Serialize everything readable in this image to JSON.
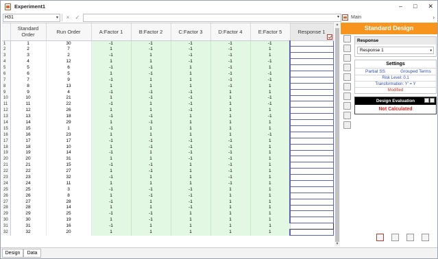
{
  "window": {
    "title": "Experiment1",
    "minimize": "–",
    "maximize": "□",
    "close": "✕"
  },
  "formula_bar": {
    "cell_ref": "H31",
    "cancel": "×",
    "confirm": "✓",
    "value": ""
  },
  "columns": [
    "Standard Order",
    "Run Order",
    "A:Factor 1",
    "B:Factor 2",
    "C:Factor 3",
    "D:Factor 4",
    "E:Factor 5",
    "Response 1"
  ],
  "rows": [
    [
      1,
      30,
      -1,
      -1,
      -1,
      -1,
      -1
    ],
    [
      2,
      7,
      1,
      -1,
      -1,
      -1,
      1
    ],
    [
      3,
      2,
      -1,
      1,
      -1,
      -1,
      1
    ],
    [
      4,
      12,
      1,
      1,
      -1,
      -1,
      -1
    ],
    [
      5,
      6,
      -1,
      -1,
      1,
      -1,
      1
    ],
    [
      6,
      5,
      1,
      -1,
      1,
      -1,
      -1
    ],
    [
      7,
      9,
      -1,
      1,
      1,
      -1,
      -1
    ],
    [
      8,
      13,
      1,
      1,
      1,
      -1,
      1
    ],
    [
      9,
      4,
      -1,
      -1,
      -1,
      1,
      1
    ],
    [
      10,
      21,
      1,
      -1,
      -1,
      1,
      -1
    ],
    [
      11,
      22,
      -1,
      1,
      -1,
      1,
      -1
    ],
    [
      12,
      26,
      1,
      1,
      -1,
      1,
      1
    ],
    [
      13,
      18,
      -1,
      -1,
      1,
      1,
      -1
    ],
    [
      14,
      29,
      1,
      -1,
      1,
      1,
      1
    ],
    [
      15,
      1,
      -1,
      1,
      1,
      1,
      1
    ],
    [
      16,
      23,
      1,
      1,
      1,
      1,
      -1
    ],
    [
      17,
      17,
      -1,
      -1,
      -1,
      -1,
      1
    ],
    [
      18,
      10,
      1,
      -1,
      -1,
      -1,
      1
    ],
    [
      19,
      14,
      -1,
      1,
      -1,
      -1,
      1
    ],
    [
      20,
      31,
      1,
      1,
      -1,
      -1,
      1
    ],
    [
      21,
      15,
      -1,
      -1,
      1,
      -1,
      1
    ],
    [
      22,
      27,
      1,
      -1,
      1,
      -1,
      1
    ],
    [
      23,
      32,
      -1,
      1,
      1,
      -1,
      1
    ],
    [
      24,
      11,
      1,
      1,
      1,
      -1,
      1
    ],
    [
      25,
      3,
      -1,
      -1,
      -1,
      1,
      1
    ],
    [
      26,
      8,
      1,
      -1,
      -1,
      1,
      1
    ],
    [
      27,
      28,
      -1,
      1,
      -1,
      1,
      1
    ],
    [
      28,
      14,
      1,
      1,
      -1,
      1,
      1
    ],
    [
      29,
      25,
      -1,
      -1,
      1,
      1,
      1
    ],
    [
      30,
      19,
      1,
      -1,
      1,
      1,
      1
    ],
    [
      31,
      16,
      -1,
      1,
      1,
      1,
      1
    ],
    [
      32,
      20,
      1,
      1,
      1,
      1,
      1
    ]
  ],
  "tabs": [
    "Design",
    "Data"
  ],
  "panel": {
    "header": "Main",
    "banner": "Standard Design",
    "response_label": "Response",
    "response_value": "Response 1",
    "settings_title": "Settings",
    "partial_ss": "Partial SS",
    "grouped_terms": "Grouped Terms",
    "risk_level": "Risk Level: 0.1",
    "transformation": "Transformation: Y' = Y",
    "modified": "Modified",
    "eval_title": "Design Evaluation",
    "eval_value": "Not Calculated"
  }
}
